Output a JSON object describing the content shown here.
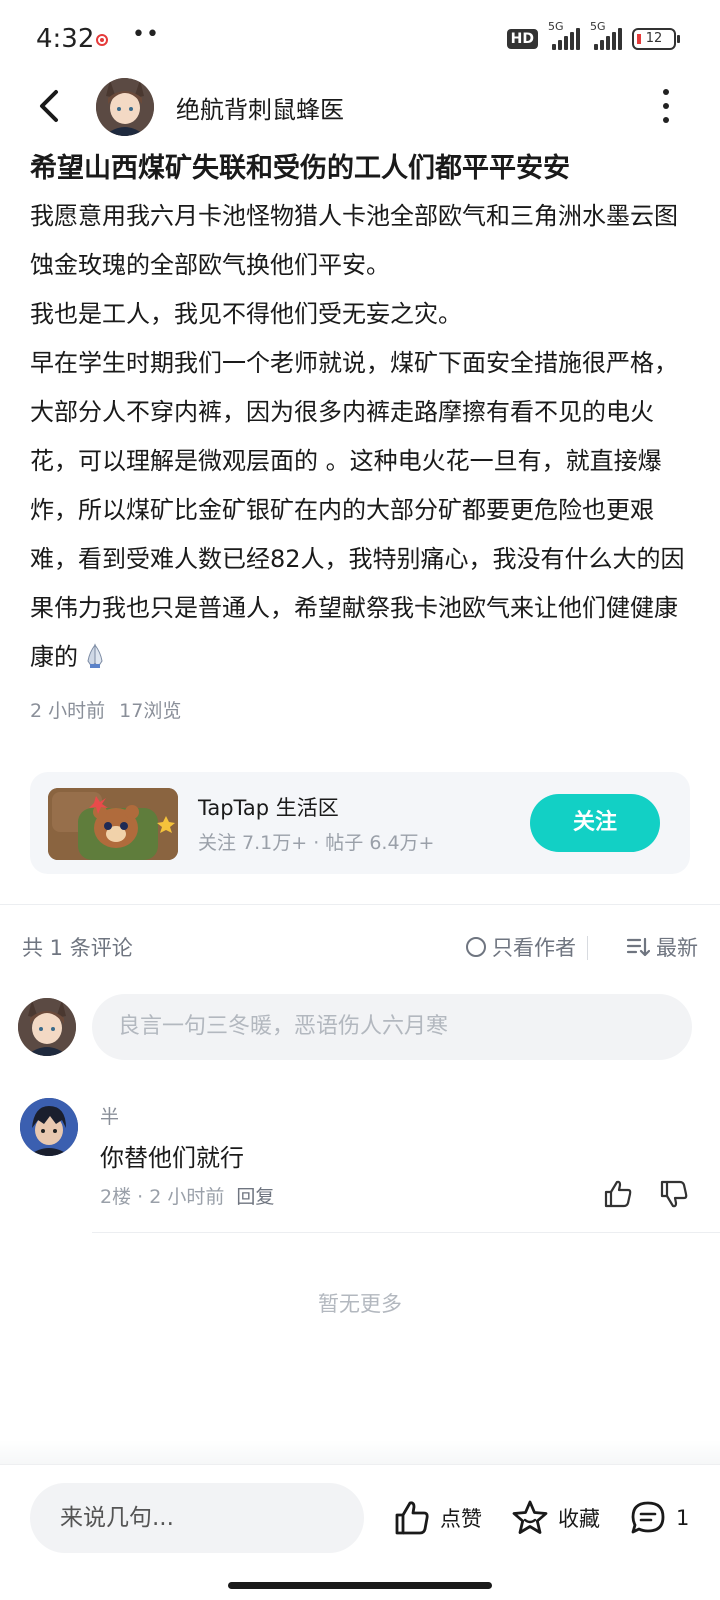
{
  "status_bar": {
    "time": "4:32",
    "hd_label": "HD",
    "signal1_label": "5G",
    "signal2_label": "5G",
    "battery_level": "12"
  },
  "author": {
    "name": "绝航背刺鼠蜂医"
  },
  "post": {
    "title": "希望山西煤矿失联和受伤的工人们都平平安安",
    "paragraphs": [
      "我愿意用我六月卡池怪物猎人卡池全部欧气和三角洲水墨云图蚀金玫瑰的全部欧气换他们平安。",
      "我也是工人，我见不得他们受无妄之灾。",
      "早在学生时期我们一个老师就说，煤矿下面安全措施很严格，大部分人不穿内裤，因为很多内裤走路摩擦有看不见的电火花，可以理解是微观层面的 。这种电火花一旦有，就直接爆炸，所以煤矿比金矿银矿在内的大部分矿都要更危险也更艰难，看到受难人数已经82人，我特别痛心，我没有什么大的因果伟力我也只是普通人，希望献祭我卡池欧气来让他们健健康康的"
    ],
    "time_ago": "2 小时前",
    "views": "17浏览"
  },
  "community": {
    "name": "TapTap 生活区",
    "stats": "关注 7.1万+ · 帖子 6.4万+",
    "follow_label": "关注"
  },
  "comments": {
    "count_label": "共 1 条评论",
    "author_only_label": "只看作者",
    "sort_label": "最新",
    "input_placeholder": "良言一句三冬暖，恶语伤人六月寒",
    "items": [
      {
        "user": "半",
        "text": "你替他们就行",
        "meta": "2楼 · 2 小时前",
        "reply_label": "回复"
      }
    ],
    "no_more_label": "暂无更多"
  },
  "bottom_bar": {
    "input_placeholder": "来说几句...",
    "like_label": "点赞",
    "favorite_label": "收藏",
    "comment_count": "1"
  },
  "colors": {
    "accent": "#12d0c5",
    "text_primary": "#1a1a1a",
    "text_secondary": "#8a8f99",
    "card_bg": "#f4f6f9"
  },
  "icons": [
    "back-arrow-icon",
    "more-vertical-icon",
    "pray-icon",
    "radio-circle-icon",
    "sort-icon",
    "thumb-up-icon",
    "thumb-down-icon",
    "star-icon",
    "comment-bubble-icon"
  ]
}
